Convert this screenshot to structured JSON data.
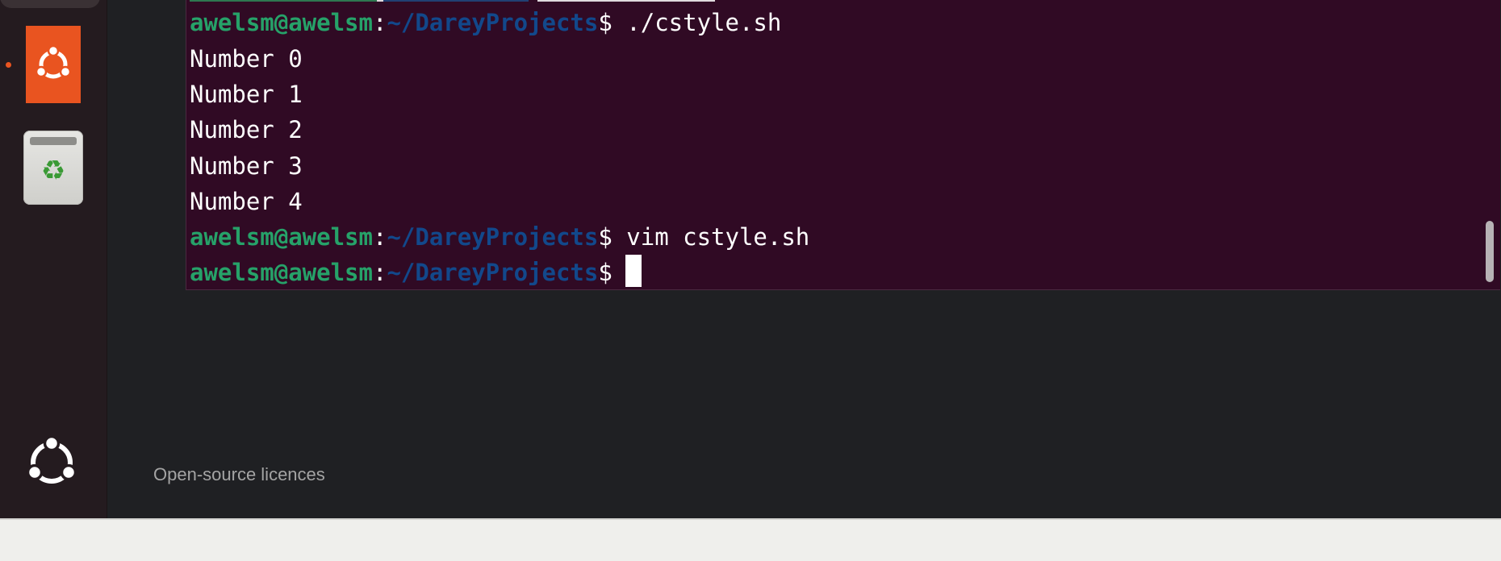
{
  "dock": {
    "apps": [
      {
        "name": "Ubuntu Software",
        "icon": "ubuntu-logo-icon",
        "running": true,
        "color": "#e95420"
      },
      {
        "name": "Trash",
        "icon": "recycle-icon"
      }
    ],
    "show_apps_icon": "ubuntu-circle-icon",
    "recycle_glyph": "♻"
  },
  "terminal": {
    "background": "#300a24",
    "prompt": {
      "user_host": "awelsm@awelsm",
      "colon": ":",
      "path": "~/DareyProjects",
      "dollar": "$",
      "user_color": "#26a269",
      "path_color": "#12488b"
    },
    "lines": [
      {
        "type": "prompt",
        "command": " ./cstyle.sh"
      },
      {
        "type": "output",
        "text": "Number 0"
      },
      {
        "type": "output",
        "text": "Number 1"
      },
      {
        "type": "output",
        "text": "Number 2"
      },
      {
        "type": "output",
        "text": "Number 3"
      },
      {
        "type": "output",
        "text": "Number 4"
      },
      {
        "type": "prompt",
        "command": " vim cstyle.sh"
      },
      {
        "type": "prompt",
        "command": ""
      }
    ]
  },
  "about": {
    "licences_label": "Open-source licences"
  }
}
